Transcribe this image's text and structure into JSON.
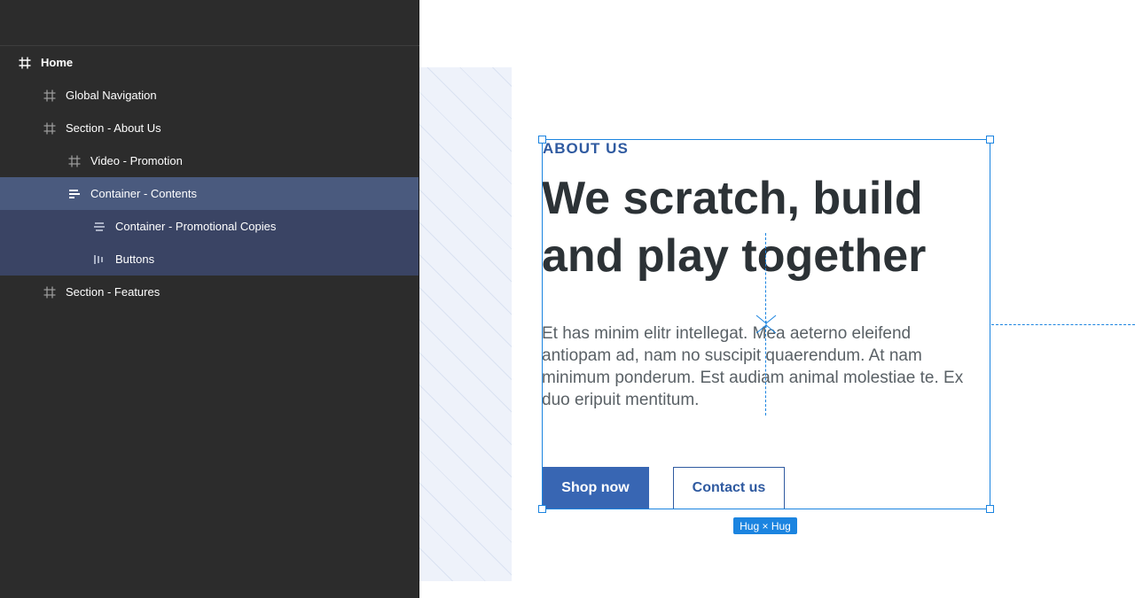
{
  "layers": [
    {
      "label": "Home",
      "icon": "frame-icon"
    },
    {
      "label": "Global Navigation",
      "icon": "frame-icon"
    },
    {
      "label": "Section - About Us",
      "icon": "frame-icon"
    },
    {
      "label": "Video - Promotion",
      "icon": "frame-icon"
    },
    {
      "label": "Container - Contents",
      "icon": "vertical-stack-left-icon"
    },
    {
      "label": "Container - Promotional Copies",
      "icon": "vertical-stack-center-icon"
    },
    {
      "label": "Buttons",
      "icon": "horizontal-stack-icon"
    },
    {
      "label": "Section - Features",
      "icon": "frame-icon"
    }
  ],
  "selected_layer": "Container - Contents",
  "canvas": {
    "eyebrow": "ABOUT US",
    "headline": "We scratch, build and play together",
    "body": "Et has minim elitr intellegat. Mea aeterno eleifend antiopam ad, nam no suscipit quaerendum. At nam minimum ponderum. Est audiam animal molestiae te. Ex duo eripuit mentitum.",
    "primary_button": "Shop now",
    "secondary_button": "Contact us"
  },
  "selection": {
    "size_badge": "Hug × Hug"
  },
  "colors": {
    "panel_bg": "#2c2c2c",
    "selected_row": "#4a5a7e",
    "selected_child_row": "#3a4464",
    "accent_blue": "#2f5aa0",
    "primary_button": "#3866b3",
    "selection_blue": "#1b84e0",
    "headline_text": "#2c3236"
  }
}
